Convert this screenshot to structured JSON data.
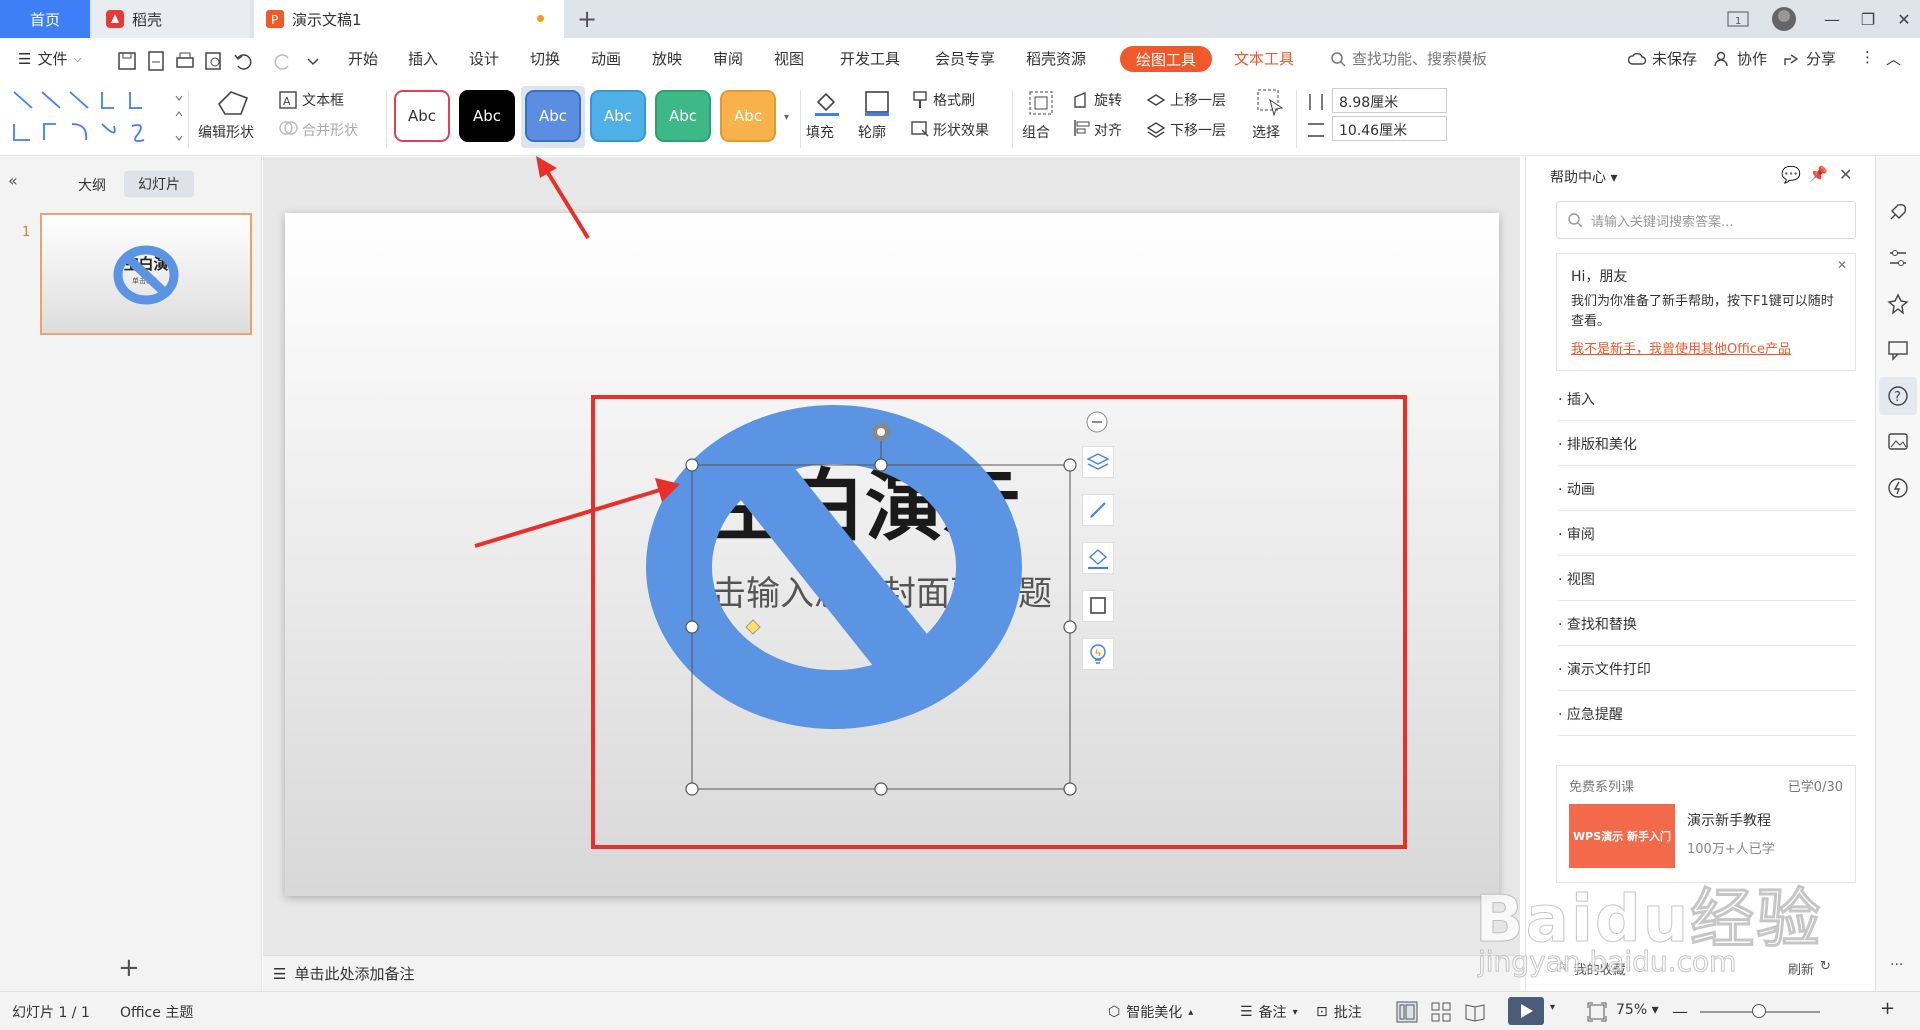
{
  "tabs": {
    "home": "首页",
    "docer": "稻壳",
    "document": "演示文稿1"
  },
  "menu": {
    "file": "文件",
    "items": [
      "开始",
      "插入",
      "设计",
      "切换",
      "动画",
      "放映",
      "审阅",
      "视图",
      "开发工具",
      "会员专享",
      "稻壳资源"
    ],
    "drawing_tools": "绘图工具",
    "text_tools": "文本工具",
    "search_placeholder": "查找功能、搜索模板",
    "unsaved": "未保存",
    "collaborate": "协作",
    "share": "分享"
  },
  "ribbon": {
    "edit_shape": "编辑形状",
    "text_box": "文本框",
    "merge_shape": "合并形状",
    "style_label": "Abc",
    "fill": "填充",
    "outline": "轮廓",
    "format_painter": "格式刷",
    "shape_effects": "形状效果",
    "group": "组合",
    "rotate": "旋转",
    "align": "对齐",
    "bring_forward": "上移一层",
    "send_backward": "下移一层",
    "select": "选择",
    "height": "8.98厘米",
    "width": "10.46厘米"
  },
  "styles": [
    {
      "bg": "#ffffff",
      "fg": "#333333",
      "border": "#e0405a"
    },
    {
      "bg": "#000000",
      "fg": "#ffffff",
      "border": "#000000"
    },
    {
      "bg": "#5b8ee0",
      "fg": "#ffffff",
      "border": "#3a6fc0"
    },
    {
      "bg": "#4fb0e8",
      "fg": "#ffffff",
      "border": "#3a98d0"
    },
    {
      "bg": "#3fb888",
      "fg": "#ffffff",
      "border": "#2ea070"
    },
    {
      "bg": "#f7b24c",
      "fg": "#ffffff",
      "border": "#e09a30"
    }
  ],
  "left_panel": {
    "outline_tab": "大纲",
    "slides_tab": "幻灯片",
    "slide_number": "1"
  },
  "slide": {
    "title_text": "空白演示",
    "subtitle_text": "单击输入您的封面副标题",
    "thumb_title": "空白演",
    "thumb_sub": "单击输入"
  },
  "notes": "单击此处添加备注",
  "help": {
    "title": "帮助中心",
    "search_placeholder": "请输入关键词搜索答案...",
    "greeting": "Hi，朋友",
    "message": "我们为你准备了新手帮助，按下F1键可以随时查看。",
    "link": "我不是新手，我曾使用其他Office产品",
    "items": [
      "插入",
      "排版和美化",
      "动画",
      "审阅",
      "视图",
      "查找和替换",
      "演示文件打印",
      "应急提醒"
    ],
    "course_header": "免费系列课",
    "course_progress": "已学0/30",
    "course_thumb": "WPS演示 新手入门",
    "course_title": "演示新手教程",
    "course_learners": "100万+人已学",
    "favorites": "我的收藏",
    "refresh": "刷新"
  },
  "status": {
    "slide_count": "幻灯片 1 / 1",
    "theme": "Office 主题",
    "beautify": "智能美化",
    "notes": "备注",
    "comments": "批注",
    "zoom": "75%"
  },
  "watermark": {
    "line1": "Baidu经验",
    "line2": "jingyan.baidu.com"
  },
  "colors": {
    "accent": "#f2592a",
    "blue": "#3e7ff5",
    "shape_blue": "#5b94e3",
    "red": "#e8302a"
  }
}
